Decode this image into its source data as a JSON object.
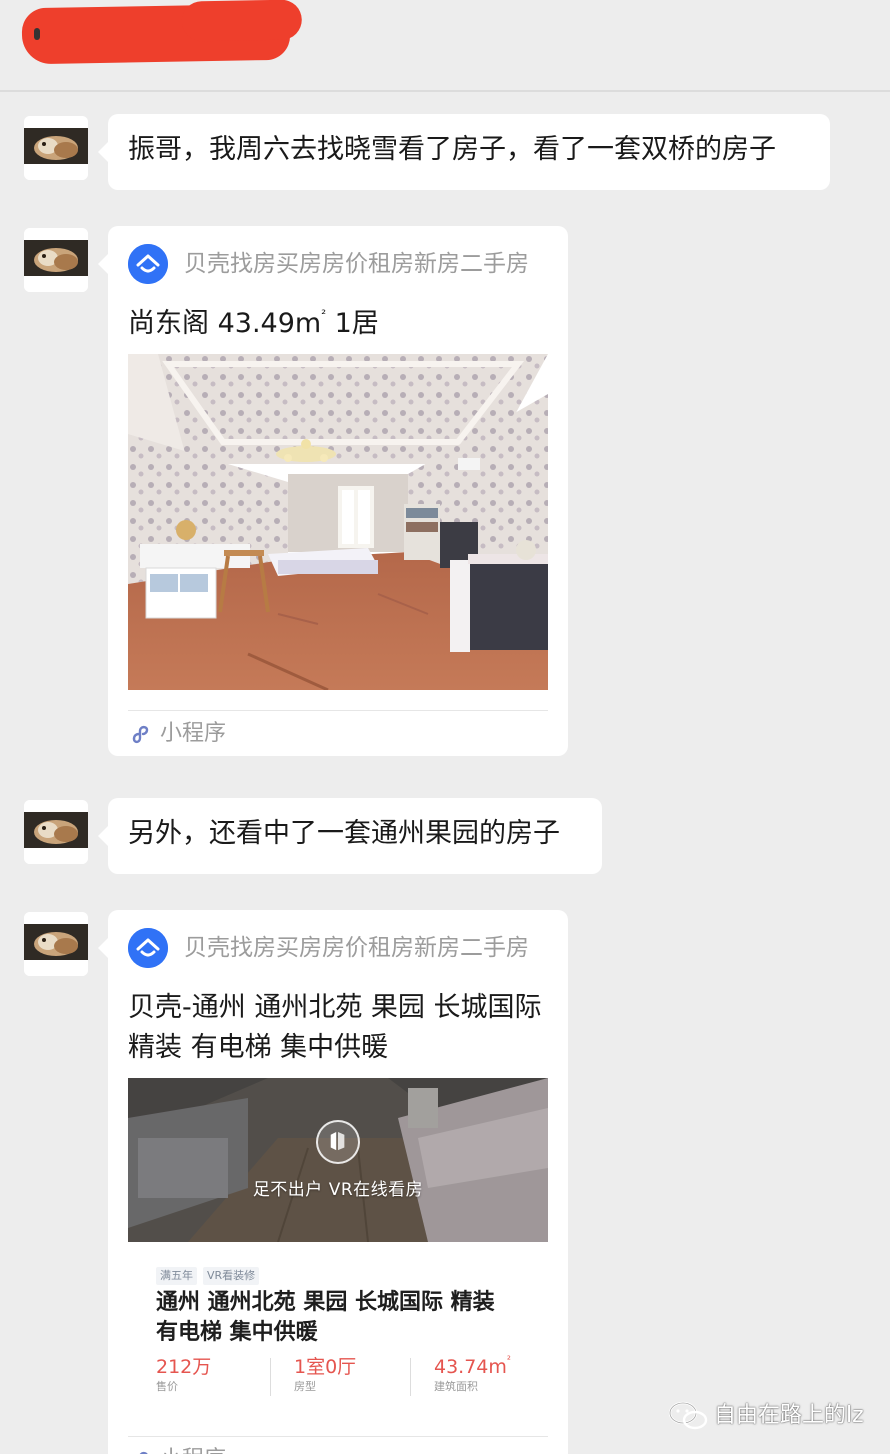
{
  "messages": [
    {
      "type": "text",
      "text": "振哥，我周六去找晓雪看了房子，看了一套双桥的房子"
    },
    {
      "type": "mini_program_card",
      "brand": "贝壳找房买房房价租房新房二手房",
      "title_main": "尚东阁 43.49m",
      "title_sup": "²",
      "title_tail": " 1居",
      "footer": "小程序"
    },
    {
      "type": "text",
      "text": "另外，还看中了一套通州果园的房子"
    },
    {
      "type": "mini_program_card",
      "brand": "贝壳找房买房房价租房新房二手房",
      "title": "贝壳-通州 通州北苑 果园 长城国际 精装 有电梯 集中供暖",
      "vr_text": "足不出户 VR在线看房",
      "tags": [
        "满五年",
        "VR看装修"
      ],
      "listing_title": "通州 通州北苑 果园 长城国际 精装 有电梯 集中供暖",
      "stats": [
        {
          "value": "212万",
          "sup": "",
          "label": "售价"
        },
        {
          "value": "1室0厅",
          "sup": "",
          "label": "房型"
        },
        {
          "value": "43.74m",
          "sup": "²",
          "label": "建筑面积"
        }
      ],
      "footer": "小程序"
    }
  ],
  "watermark": {
    "text": "自由在路上的lz"
  },
  "colors": {
    "background": "#ededed",
    "bubble": "#ffffff",
    "brand": "#3072f6",
    "price": "#e5554f",
    "redaction": "#ee3f2c"
  }
}
